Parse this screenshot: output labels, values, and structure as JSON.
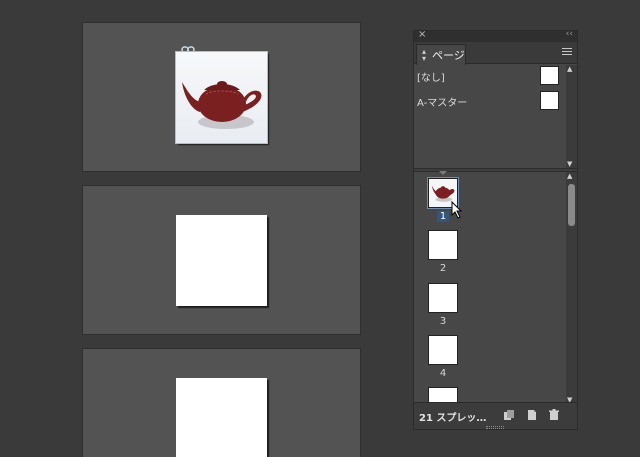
{
  "panel": {
    "close_icon": "close-icon",
    "collapse_label": "‹‹",
    "tab_label": "ページ",
    "menu_icon": "panel-menu-icon"
  },
  "masters": [
    {
      "label": "[なし]"
    },
    {
      "label": "A-マスター"
    }
  ],
  "pages": [
    {
      "number": "1",
      "selected": true,
      "has_teapot": true
    },
    {
      "number": "2",
      "selected": false
    },
    {
      "number": "3",
      "selected": false
    },
    {
      "number": "4",
      "selected": false
    },
    {
      "number": "",
      "selected": false
    }
  ],
  "footer": {
    "status_text": "21 スプレッ…",
    "buttons": [
      "edit-page-size-icon",
      "new-page-icon",
      "delete-page-icon"
    ]
  },
  "colors": {
    "teapot": "#7a2020",
    "selection": "#34557c",
    "panel_bg": "#474747"
  }
}
